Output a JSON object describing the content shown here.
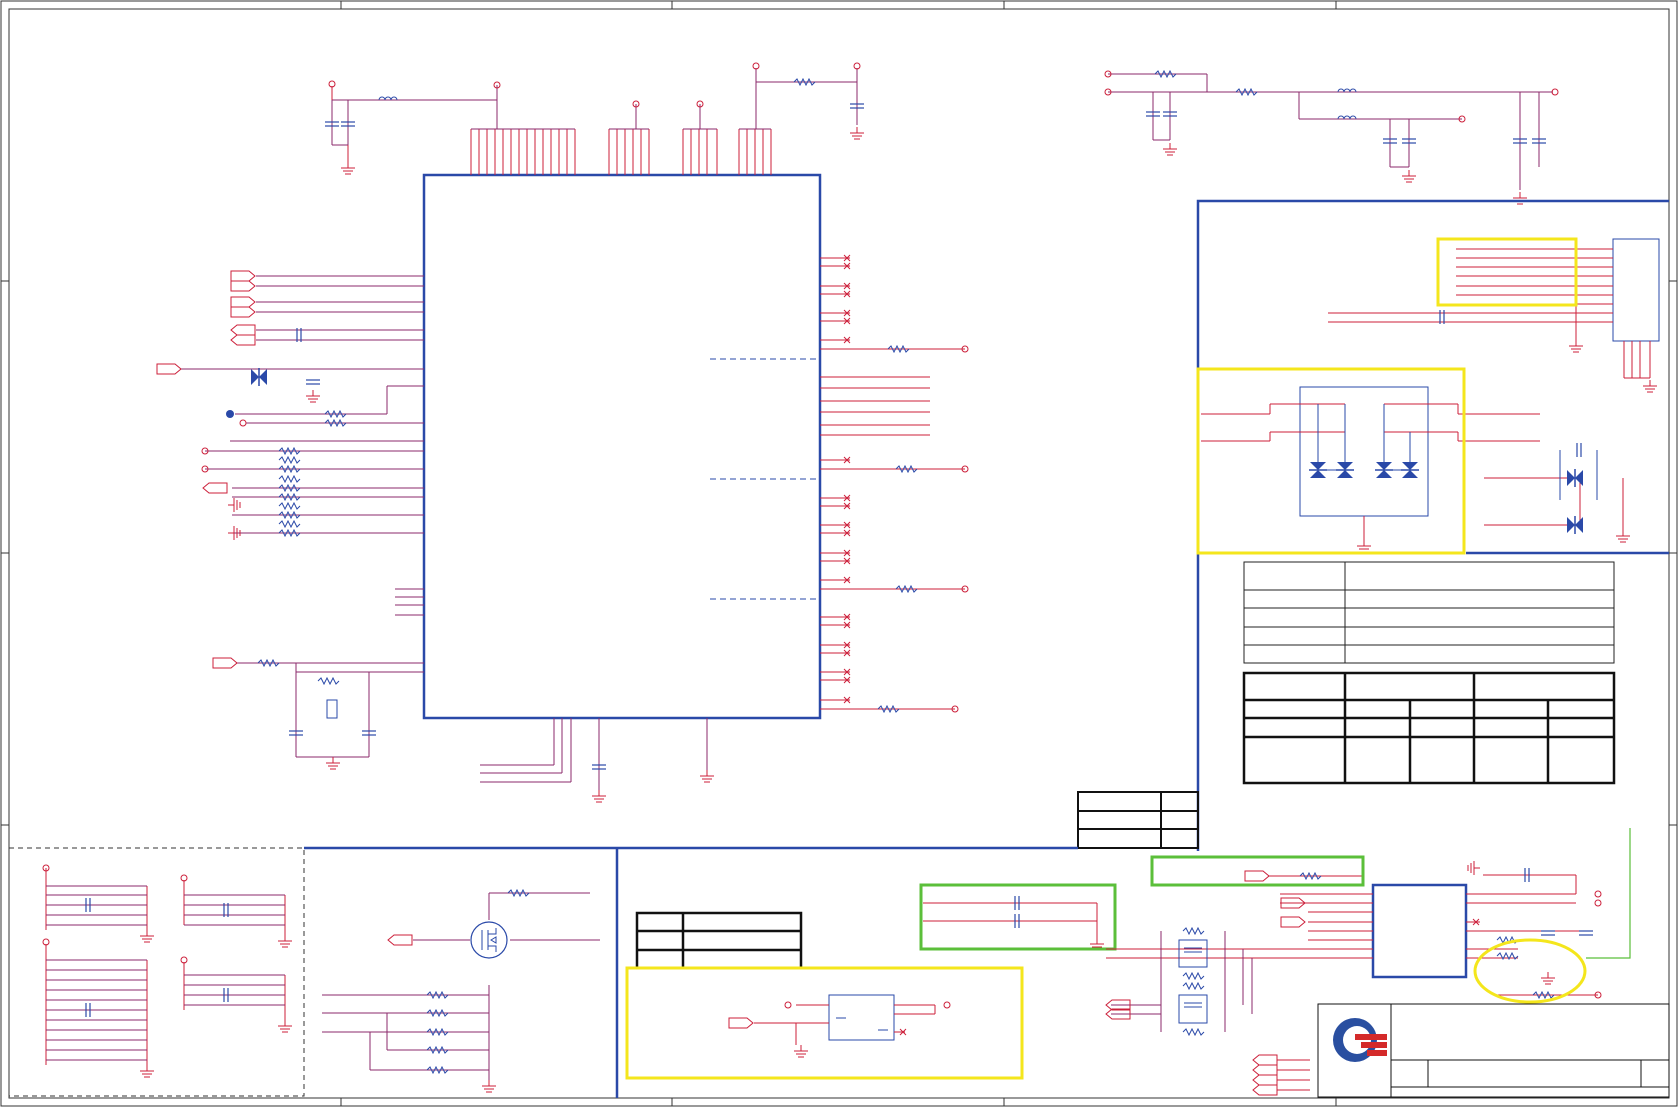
{
  "colors": {
    "wire": "#cc1f3a",
    "net": "#8b2a6b",
    "part": "#2a49a8",
    "block": "#2a49a8",
    "highlight_yellow": "#f4e61c",
    "highlight_green": "#5bbf3a",
    "table": "#111111",
    "frame": "#333333",
    "logo_blue": "#2a4fa0",
    "logo_red": "#d42a2a"
  },
  "sheet": {
    "component_icons": {
      "resistor": "zigzag-resistor-icon",
      "capacitor": "capacitor-icon",
      "inductor": "inductor-icon",
      "ground": "ground-icon",
      "power_port": "power-port-icon",
      "offpage_connector": "offpage-connector-icon",
      "no_connect": "no-connect-icon",
      "tvs_diode": "tvs-diode-icon",
      "transistor": "mosfet-icon",
      "crystal": "crystal-icon",
      "transformer": "transformer-icon"
    }
  }
}
